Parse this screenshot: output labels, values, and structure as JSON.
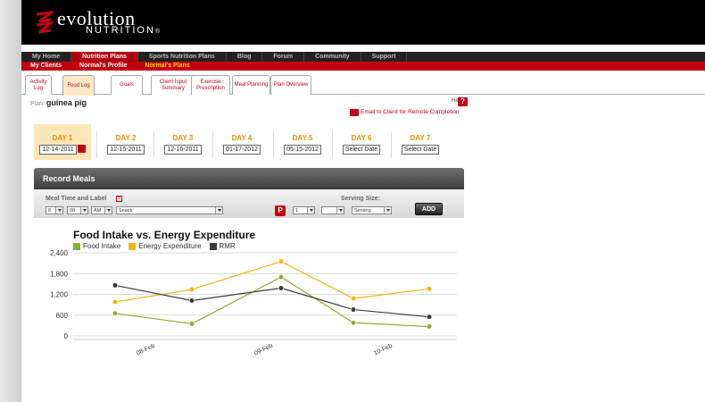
{
  "brand": {
    "name_main": "evolution",
    "name_sub": "NUTRITION",
    "reg": "®"
  },
  "topnav": [
    {
      "label": "My Home",
      "active": false
    },
    {
      "label": "Nutrition Plans",
      "active": true
    },
    {
      "label": "Sports Nutrition Plans",
      "active": false
    },
    {
      "label": "Blog",
      "active": false
    },
    {
      "label": "Forum",
      "active": false
    },
    {
      "label": "Community",
      "active": false
    },
    {
      "label": "Support",
      "active": false
    }
  ],
  "subnav": [
    {
      "label": "My Clients",
      "active": false
    },
    {
      "label": "Normal's Profile",
      "active": false
    },
    {
      "label": "Normal's Plans",
      "active": true
    }
  ],
  "tabs": [
    {
      "label": "Activity Log",
      "active": false
    },
    {
      "label": "Food Log",
      "active": true
    },
    {
      "label": "Goals",
      "active": false
    },
    {
      "label": "Client Input Summary",
      "active": false
    },
    {
      "label": "Exercise Prescription",
      "active": false
    },
    {
      "label": "Meal Planning",
      "active": false
    },
    {
      "label": "Plan Overview",
      "active": false
    }
  ],
  "plan": {
    "prefix": "Plan:",
    "name": "guinea pig"
  },
  "help": {
    "label": "Help",
    "icon": "question-icon"
  },
  "email_link": "Email to Client for Remote Completion",
  "days": [
    {
      "label": "DAY 1",
      "date": "12-14-2011",
      "active": true
    },
    {
      "label": "DAY 2",
      "date": "12-15-2011",
      "active": false
    },
    {
      "label": "DAY 3",
      "date": "12-16-2011",
      "active": false
    },
    {
      "label": "DAY 4",
      "date": "01-17-2012",
      "active": false
    },
    {
      "label": "DAY 5",
      "date": "05-15-2012",
      "active": false
    },
    {
      "label": "DAY 6",
      "date": "Select Date",
      "active": false
    },
    {
      "label": "DAY 7",
      "date": "Select Date",
      "active": false
    }
  ],
  "record_meals": {
    "title": "Record Meals",
    "meal_time_label": "Meal Time and Label",
    "hour": "8",
    "minute": "00",
    "ampm": "AM",
    "meal_label": "Snack",
    "serving_size_label": "Serving Size:",
    "qty": "1",
    "fraction": "",
    "unit": "Serving",
    "add_label": "ADD"
  },
  "chart_data": {
    "type": "line",
    "title": "Food Intake vs. Energy Expenditure",
    "x_tick_labels": [
      "08-Feb",
      "09-Feb",
      "10-Feb"
    ],
    "ylim": [
      0,
      2400
    ],
    "y_ticks": [
      "2,400",
      "1,800",
      "1,200",
      "600",
      "0"
    ],
    "y_tick_values": [
      2400,
      1800,
      1200,
      600,
      0
    ],
    "grid": true,
    "legend_position": "top-left",
    "series": [
      {
        "name": "Food Intake",
        "color": "#8cae2e",
        "values": [
          650,
          350,
          1700,
          380,
          270
        ]
      },
      {
        "name": "Energy Expenditure",
        "color": "#f3b511",
        "values": [
          980,
          1340,
          2150,
          1080,
          1360
        ]
      },
      {
        "name": "RMR",
        "color": "#3c3c3c",
        "values": [
          1460,
          1020,
          1380,
          760,
          550
        ]
      }
    ]
  }
}
